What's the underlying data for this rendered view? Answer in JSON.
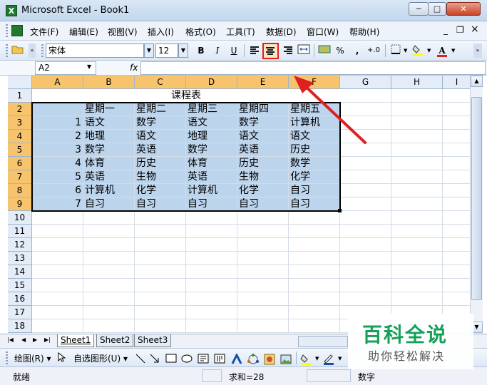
{
  "window": {
    "title": "Microsoft Excel - Book1",
    "app_icon": "X"
  },
  "window_controls": {
    "minimize": "─",
    "maximize": "□",
    "close": "✕"
  },
  "menu": [
    "文件(F)",
    "编辑(E)",
    "视图(V)",
    "插入(I)",
    "格式(O)",
    "工具(T)",
    "数据(D)",
    "窗口(W)",
    "帮助(H)"
  ],
  "doc_controls": {
    "minimize": "_",
    "restore": "❐",
    "close": "×"
  },
  "toolbar": {
    "font_name": "宋体",
    "font_size": "12",
    "bold": "B",
    "italic": "I",
    "underline": "U",
    "percent": "%",
    "comma": ",",
    "increase_decimal": "+.0",
    "font_color_letter": "A"
  },
  "formula_bar": {
    "name_box": "A2",
    "fx": "fx",
    "value": ""
  },
  "columns": [
    "A",
    "B",
    "C",
    "D",
    "E",
    "F",
    "G",
    "H",
    "I"
  ],
  "rows": [
    "1",
    "2",
    "3",
    "4",
    "5",
    "6",
    "7",
    "8",
    "9",
    "10",
    "11",
    "12",
    "13",
    "14",
    "15",
    "16",
    "17",
    "18"
  ],
  "sheet": {
    "title": "课程表",
    "header": [
      "",
      "星期一",
      "星期二",
      "星期三",
      "星期四",
      "星期五"
    ],
    "data": [
      [
        "1",
        "语文",
        "数学",
        "语文",
        "数学",
        "计算机"
      ],
      [
        "2",
        "地理",
        "语文",
        "地理",
        "语文",
        "语文"
      ],
      [
        "3",
        "数学",
        "英语",
        "数学",
        "英语",
        "历史"
      ],
      [
        "4",
        "体育",
        "历史",
        "体育",
        "历史",
        "数学"
      ],
      [
        "5",
        "英语",
        "生物",
        "英语",
        "生物",
        "化学"
      ],
      [
        "6",
        "计算机",
        "化学",
        "计算机",
        "化学",
        "自习"
      ],
      [
        "7",
        "自习",
        "自习",
        "自习",
        "自习",
        "自习"
      ]
    ]
  },
  "tabs": {
    "nav": [
      "|◀",
      "◀",
      "▶",
      "▶|"
    ],
    "sheets": [
      "Sheet1",
      "Sheet2",
      "Sheet3"
    ]
  },
  "drawing": {
    "draw_label": "绘图(R)",
    "autoshapes_label": "自选图形(U)"
  },
  "status": {
    "ready": "就绪",
    "sum": "求和=28",
    "mode": "数字"
  },
  "watermark": {
    "main": "百科全说",
    "sub": "助你轻松解决"
  },
  "colors": {
    "highlight": "#f7c36d",
    "selection": "#bcd4ec",
    "annotation": "#e02020",
    "brand": "#17a05a"
  }
}
